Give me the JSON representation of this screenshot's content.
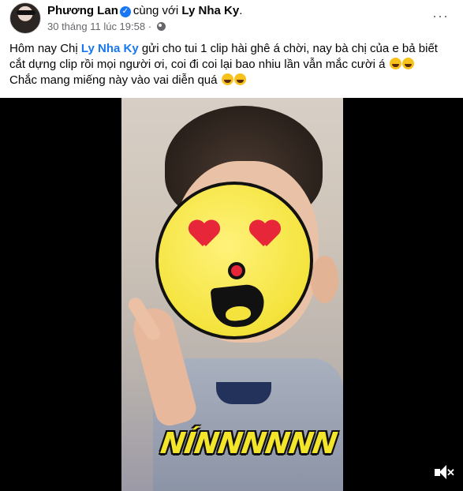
{
  "post": {
    "author": "Phương Lan",
    "with_text": "cùng với",
    "tagged": "Ly Nha Ky",
    "tagged_suffix": ".",
    "timestamp": "30 tháng 11 lúc 19:58",
    "timestamp_sep": "·",
    "more_label": "···",
    "caption": {
      "part1": "Hôm nay Chị ",
      "mention": "Ly Nha Ky",
      "part2": " gửi cho tui 1 clip hài ghê á chời, nay bà chị của e bả biết cắt dựng clip rồi mọi người ơi, coi đi coi lại bao nhiu lần vẫn mắc cười á ",
      "line2": "Chắc mang miếng này vào vai diễn quá "
    }
  },
  "icons": {
    "verified": "verified-badge-icon",
    "globe": "globe-icon",
    "emoji": "rolling-laughing-emoji-icon",
    "mute": "speaker-muted-icon"
  },
  "video": {
    "overlay_text": "NÍNNNNNN"
  },
  "colors": {
    "accent": "#1877f2",
    "meta": "#65676b",
    "video_bg": "#000000",
    "overlay_text": "#f3e52a"
  }
}
